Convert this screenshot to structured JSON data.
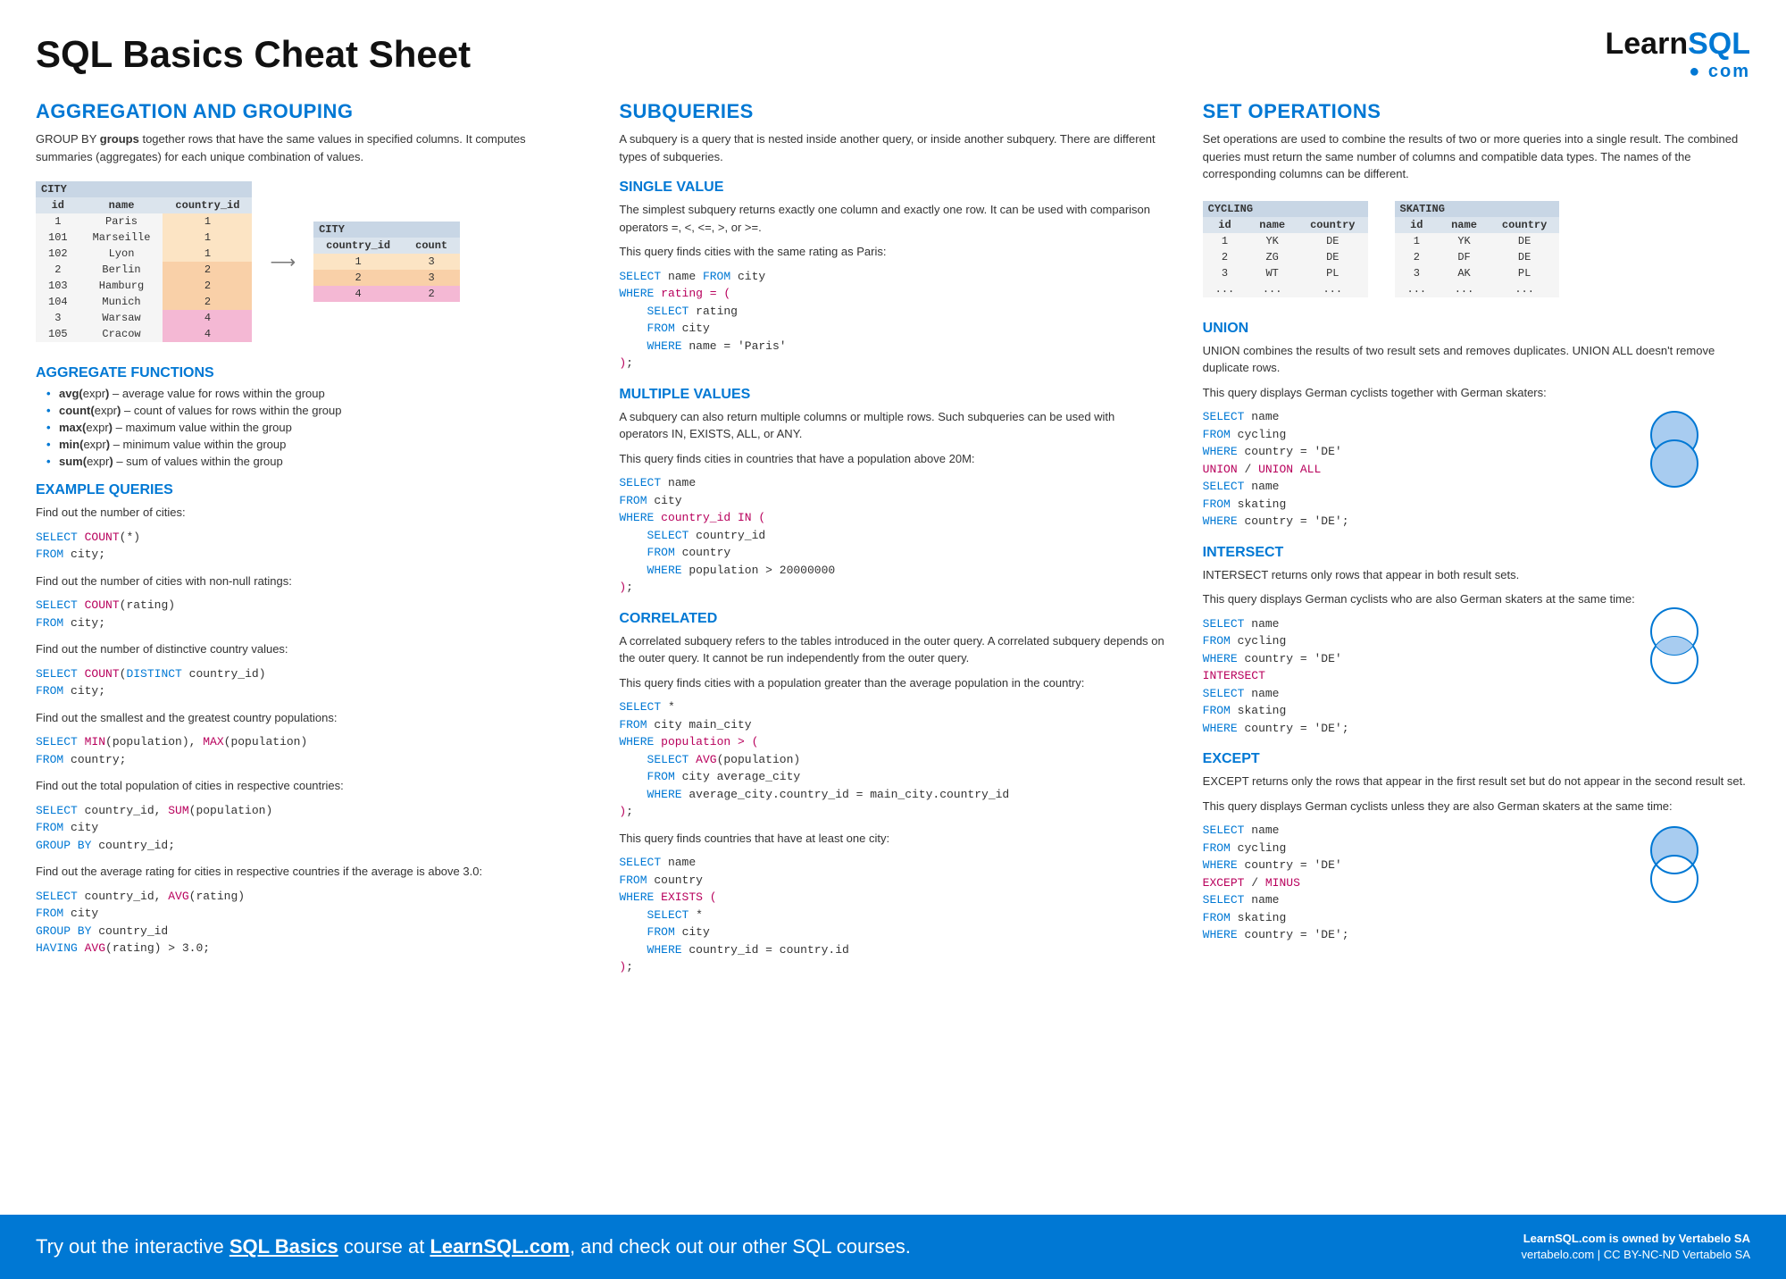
{
  "title": "SQL Basics Cheat Sheet",
  "logo": {
    "learn": "Learn",
    "sql": "SQL",
    "sub": "com"
  },
  "col1": {
    "h2": "AGGREGATION AND GROUPING",
    "intro1a": "GROUP BY ",
    "intro1b": "groups",
    "intro1c": " together rows that have the same values in specified columns. It computes summaries (aggregates) for each unique combination of values.",
    "cityTable": {
      "title": "CITY",
      "headers": [
        "id",
        "name",
        "country_id"
      ],
      "rows": [
        [
          "1",
          "Paris",
          "1"
        ],
        [
          "101",
          "Marseille",
          "1"
        ],
        [
          "102",
          "Lyon",
          "1"
        ],
        [
          "2",
          "Berlin",
          "2"
        ],
        [
          "103",
          "Hamburg",
          "2"
        ],
        [
          "104",
          "Munich",
          "2"
        ],
        [
          "3",
          "Warsaw",
          "4"
        ],
        [
          "105",
          "Cracow",
          "4"
        ]
      ],
      "rowClasses": [
        "c1",
        "c1",
        "c1",
        "c2",
        "c2",
        "c2",
        "c4",
        "c4"
      ]
    },
    "cityAgg": {
      "title": "CITY",
      "headers": [
        "country_id",
        "count"
      ],
      "rows": [
        [
          "1",
          "3"
        ],
        [
          "2",
          "3"
        ],
        [
          "4",
          "2"
        ]
      ],
      "rowClasses": [
        "c1",
        "c2",
        "c4"
      ]
    },
    "h3agg": "AGGREGATE FUNCTIONS",
    "aggFns": [
      {
        "fn": "avg(",
        "e": "expr",
        "close": ")",
        "desc": " – average value for rows within the group"
      },
      {
        "fn": "count(",
        "e": "expr",
        "close": ")",
        "desc": " – count of values for rows within the group"
      },
      {
        "fn": "max(",
        "e": "expr",
        "close": ")",
        "desc": " – maximum value within the group"
      },
      {
        "fn": "min(",
        "e": "expr",
        "close": ")",
        "desc": " – minimum value within the group"
      },
      {
        "fn": "sum(",
        "e": "expr",
        "close": ")",
        "desc": " – sum of values within the group"
      }
    ],
    "h3ex": "EXAMPLE QUERIES",
    "ex1t": "Find out the number of cities:",
    "ex2t": "Find out the number of cities with non-null ratings:",
    "ex3t": "Find out the number of distinctive country values:",
    "ex4t": "Find out the smallest and the greatest country populations:",
    "ex5t": "Find out the total population of cities in respective countries:",
    "ex6t": "Find out the average rating for cities in respective countries if the average is above 3.0:"
  },
  "col2": {
    "h2": "SUBQUERIES",
    "intro": "A subquery is a query that is nested inside another query, or inside another subquery. There are different types of subqueries.",
    "h3a": "SINGLE VALUE",
    "p1": "The simplest subquery returns exactly one column and exactly one row. It can be used with comparison operators =, <, <=, >, or >=.",
    "p2": "This query finds cities with the same rating as Paris:",
    "h3b": "MULTIPLE VALUES",
    "p3": "A subquery can also return multiple columns or multiple rows. Such subqueries can be used with operators IN, EXISTS, ALL, or ANY.",
    "p4": "This query finds cities in countries that have a population above 20M:",
    "h3c": "CORRELATED",
    "p5": "A correlated subquery refers to the tables introduced in the outer query. A correlated subquery depends on the outer query. It cannot be run independently from the outer query.",
    "p6": "This query finds cities with a population greater than the average population in the country:",
    "p7": "This query finds countries that have at least one city:"
  },
  "col3": {
    "h2": "SET OPERATIONS",
    "intro": "Set operations are used to combine the results of two or more queries into a single result. The combined queries must return the same number of columns and compatible data types. The names of the corresponding columns can be different.",
    "cycling": {
      "title": "CYCLING",
      "headers": [
        "id",
        "name",
        "country"
      ],
      "rows": [
        [
          "1",
          "YK",
          "DE"
        ],
        [
          "2",
          "ZG",
          "DE"
        ],
        [
          "3",
          "WT",
          "PL"
        ],
        [
          "...",
          "...",
          "..."
        ]
      ]
    },
    "skating": {
      "title": "SKATING",
      "headers": [
        "id",
        "name",
        "country"
      ],
      "rows": [
        [
          "1",
          "YK",
          "DE"
        ],
        [
          "2",
          "DF",
          "DE"
        ],
        [
          "3",
          "AK",
          "PL"
        ],
        [
          "...",
          "...",
          "..."
        ]
      ]
    },
    "h3u": "UNION",
    "pu1": "UNION combines the results of two result sets and removes duplicates. UNION ALL doesn't remove duplicate rows.",
    "pu2": "This query displays German cyclists together with German skaters:",
    "h3i": "INTERSECT",
    "pi1": "INTERSECT returns only rows that appear in both result sets.",
    "pi2": "This query displays German cyclists who are also German skaters at the same time:",
    "h3e": "EXCEPT",
    "pe1": "EXCEPT returns only the rows that appear in the first result set but do not appear in the second result set.",
    "pe2": "This query displays German cyclists unless they are also German skaters at the same time:"
  },
  "footer": {
    "leftA": "Try out the interactive ",
    "leftB": "SQL Basics",
    "leftC": " course at ",
    "leftD": "LearnSQL.com",
    "leftE": ", and check out our other SQL courses.",
    "r1": "LearnSQL.com is owned by Vertabelo SA",
    "r2": "vertabelo.com | CC BY-NC-ND Vertabelo SA"
  }
}
